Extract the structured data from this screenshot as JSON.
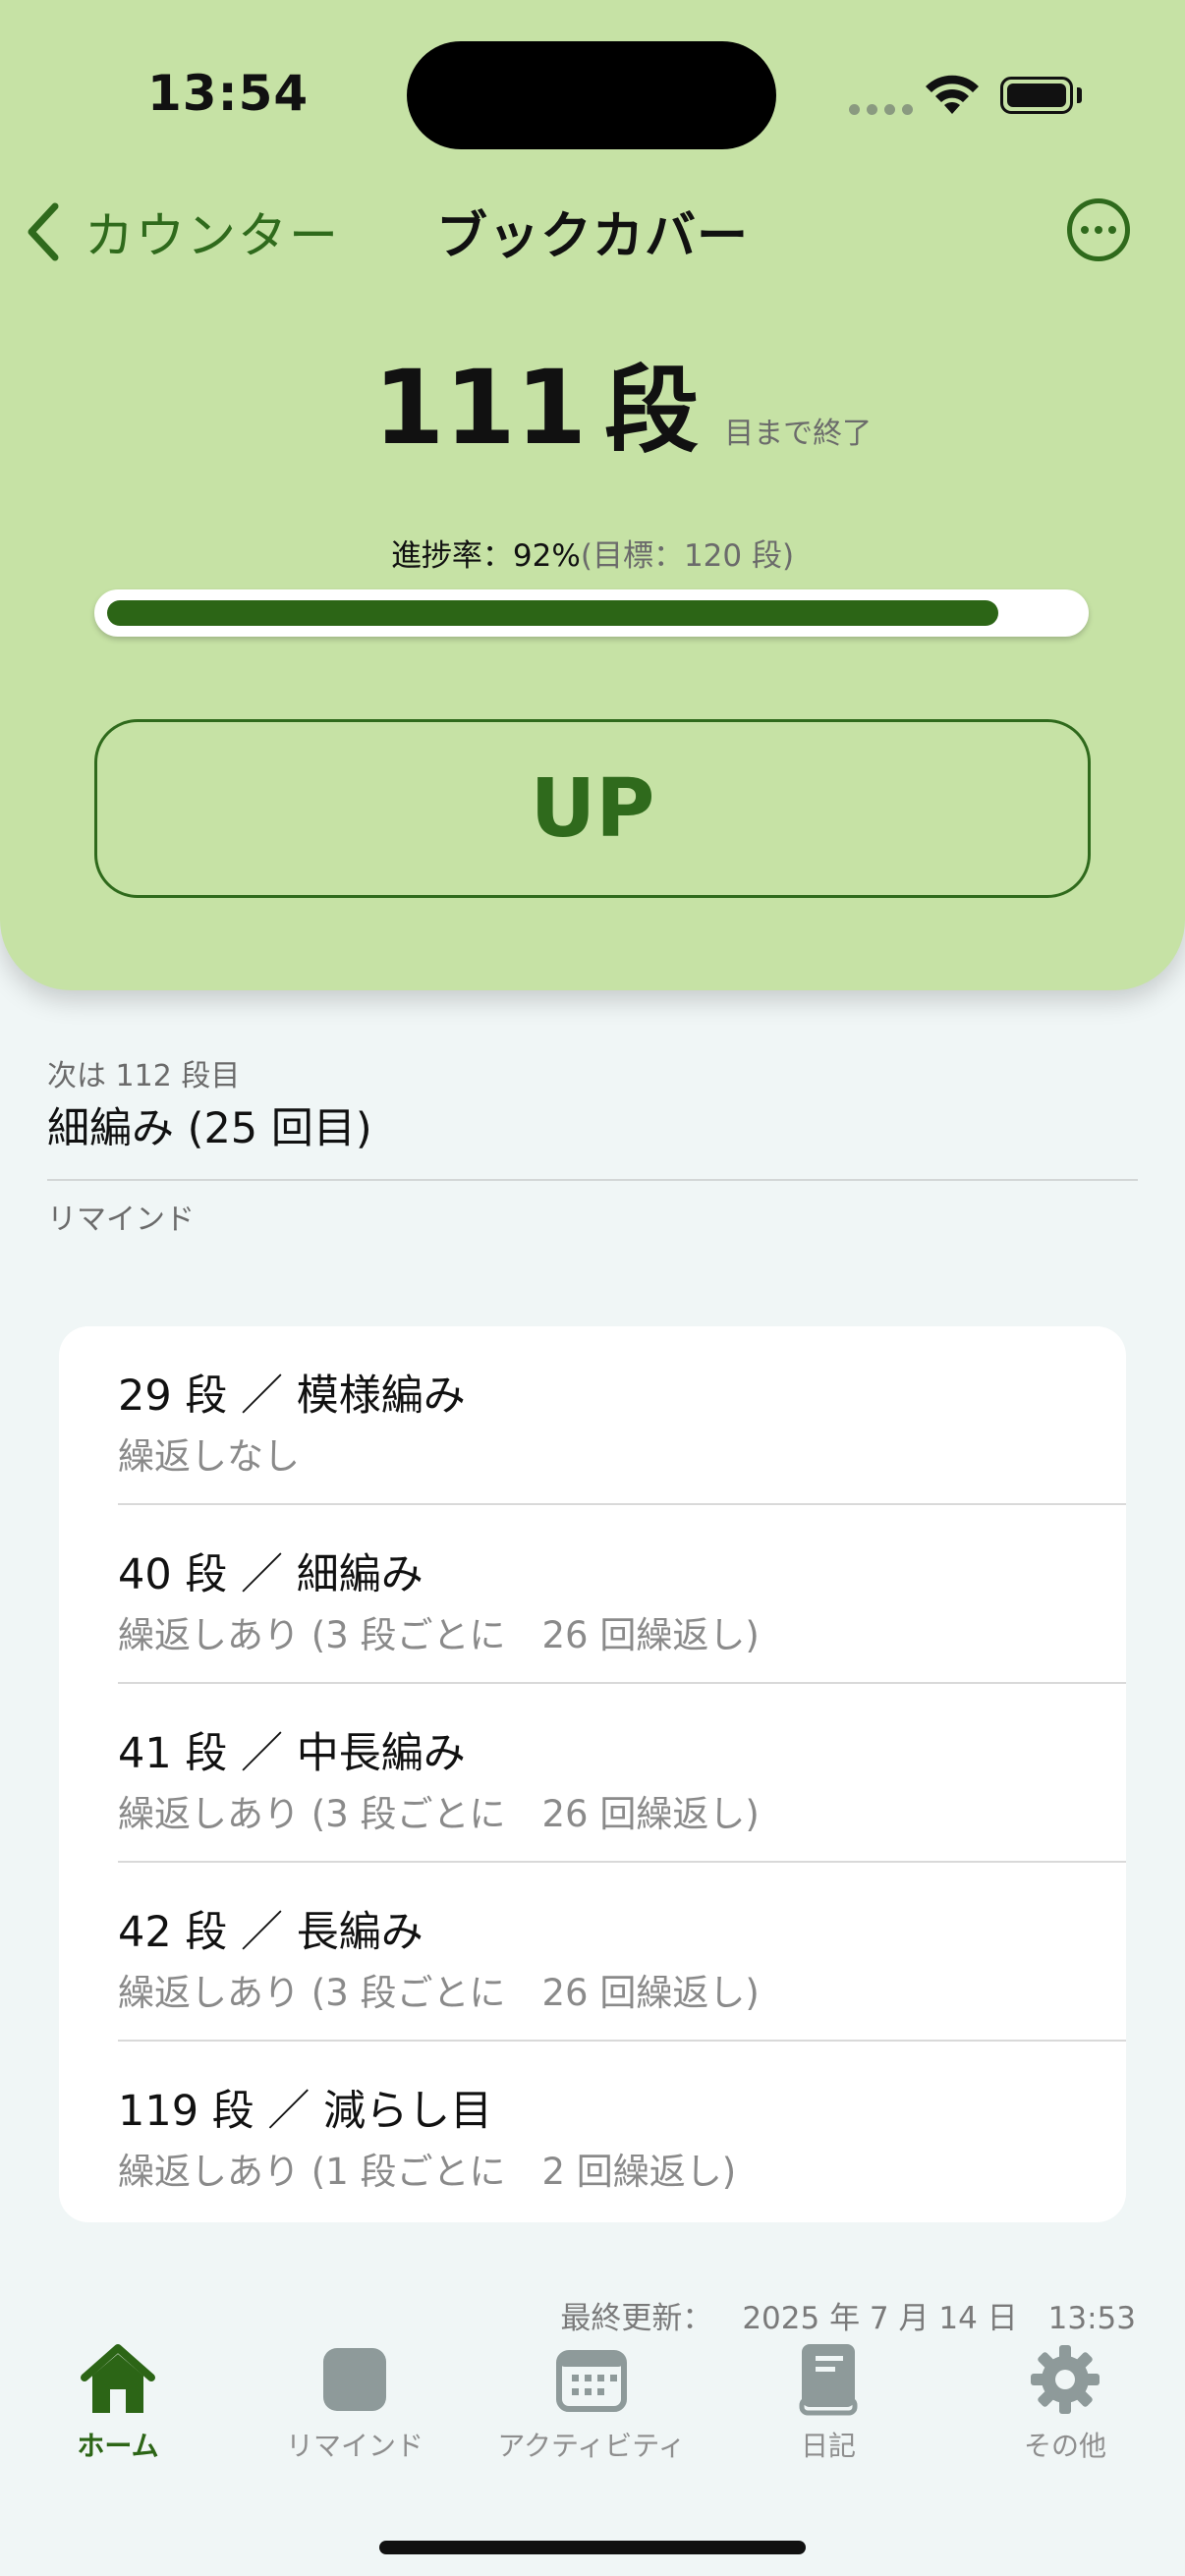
{
  "status_bar": {
    "time": "13:54"
  },
  "nav": {
    "back_label": "カウンター",
    "title": "ブックカバー"
  },
  "counter": {
    "value": "111",
    "unit": "段",
    "note": "目まで終了"
  },
  "progress": {
    "label": "進捗率：92%",
    "target": "(目標：120 段)",
    "fraction": 0.92
  },
  "up_button": {
    "label": "UP"
  },
  "next": {
    "label": "次は 112 段目",
    "pattern": "細編み (25 回目)"
  },
  "remind_section": {
    "label": "リマインド"
  },
  "remind_items": [
    {
      "title": "29 段 ／ 模様編み",
      "sub": "繰返しなし"
    },
    {
      "title": "40 段 ／ 細編み",
      "sub": "繰返しあり (3 段ごとに　26 回繰返し)"
    },
    {
      "title": "41 段 ／ 中長編み",
      "sub": "繰返しあり (3 段ごとに　26 回繰返し)"
    },
    {
      "title": "42 段 ／ 長編み",
      "sub": "繰返しあり (3 段ごとに　26 回繰返し)"
    },
    {
      "title": "119 段 ／ 減らし目",
      "sub": "繰返しあり (1 段ごとに　2 回繰返し)"
    }
  ],
  "last_updated": {
    "label": "最終更新：",
    "value": "2025 年 7 月 14 日　13:53"
  },
  "tabs": [
    {
      "label": "ホーム",
      "icon": "home-icon",
      "active": true
    },
    {
      "label": "リマインド",
      "icon": "square-icon",
      "active": false
    },
    {
      "label": "アクティビティ",
      "icon": "calendar-icon",
      "active": false
    },
    {
      "label": "日記",
      "icon": "book-icon",
      "active": false
    },
    {
      "label": "その他",
      "icon": "gear-icon",
      "active": false
    }
  ],
  "colors": {
    "header_bg": "#c6e2a5",
    "accent": "#2c6516",
    "page_bg": "#f0f6f6"
  }
}
